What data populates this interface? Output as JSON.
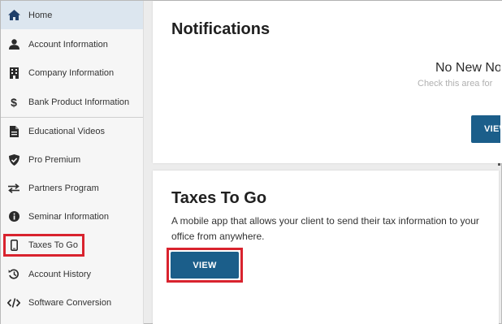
{
  "sidebar": {
    "items": [
      {
        "label": "Home",
        "icon": "home-icon"
      },
      {
        "label": "Account Information",
        "icon": "user-icon"
      },
      {
        "label": "Company Information",
        "icon": "building-icon"
      },
      {
        "label": "Bank Product Information",
        "icon": "dollar-icon"
      },
      {
        "label": "Educational Videos",
        "icon": "document-icon"
      },
      {
        "label": "Pro Premium",
        "icon": "shield-check-icon"
      },
      {
        "label": "Partners Program",
        "icon": "swap-arrows-icon"
      },
      {
        "label": "Seminar Information",
        "icon": "info-icon"
      },
      {
        "label": "Taxes To Go",
        "icon": "mobile-phone-icon"
      },
      {
        "label": "Account History",
        "icon": "history-icon"
      },
      {
        "label": "Software Conversion",
        "icon": "code-icon"
      }
    ],
    "active_item": "Home",
    "highlighted_item": "Taxes To Go"
  },
  "notifications": {
    "title": "Notifications",
    "empty_heading": "No New No",
    "empty_subtext": "Check this area for",
    "view_label": "VIEW"
  },
  "taxes_to_go": {
    "title": "Taxes To Go",
    "description": "A mobile app that allows your client to send their tax information to your office from anywhere.",
    "view_label": "VIEW"
  },
  "colors": {
    "accent": "#1b5e8a",
    "highlight": "#d9232e",
    "active_bg": "#dce6ef"
  }
}
